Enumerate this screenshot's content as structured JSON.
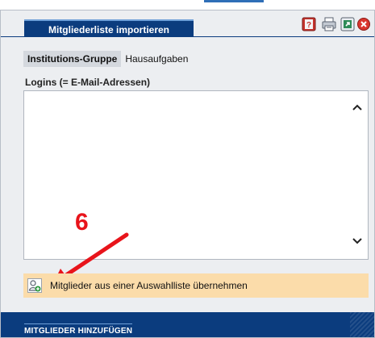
{
  "window": {
    "title": "Mitgliederliste importieren",
    "buttons": [
      {
        "name": "help-icon"
      },
      {
        "name": "print-icon"
      },
      {
        "name": "export-icon"
      },
      {
        "name": "close-icon"
      }
    ]
  },
  "tabs": [
    {
      "label": "Institutions-Gruppe",
      "active": true
    },
    {
      "label": "Hausaufgaben",
      "active": false
    }
  ],
  "logins": {
    "label": "Logins (= E-Mail-Adressen)",
    "value": ""
  },
  "annotation": {
    "number": "6",
    "color": "#e8141b"
  },
  "action": {
    "label": "Mitglieder aus einer Auswahlliste übernehmen",
    "icon": "add-user-icon",
    "background": "#fbdcaa"
  },
  "footer": {
    "button_label": "MITGLIEDER HINZUFÜGEN"
  },
  "colors": {
    "accent": "#0b3c7e",
    "window_bg": "#eceef1"
  }
}
